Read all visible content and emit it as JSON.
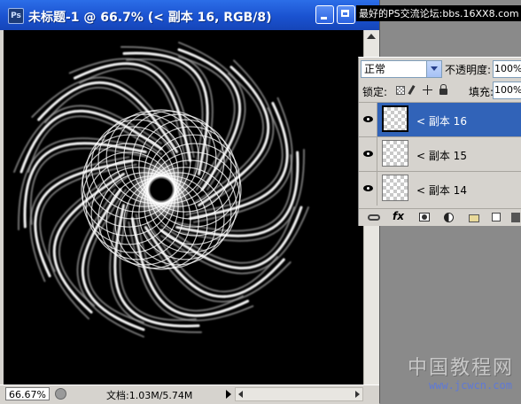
{
  "document": {
    "title": "未标题-1 @ 66.7% (< 副本 16, RGB/8)"
  },
  "banner": {
    "text": "最好的PS交流论坛:bbs.16XX8.com"
  },
  "status_bar": {
    "zoom": "66.67%",
    "doc_info": "文档:1.03M/5.74M"
  },
  "layers_panel": {
    "blend_mode": "正常",
    "opacity_label": "不透明度:",
    "opacity_value": "100%",
    "lock_label": "锁定:",
    "fill_label": "填充:",
    "fill_value": "100%",
    "layers": [
      {
        "name": "< 副本 16",
        "selected": true,
        "visible": true
      },
      {
        "name": "< 副本 15",
        "selected": false,
        "visible": true
      },
      {
        "name": "< 副本 14",
        "selected": false,
        "visible": true
      }
    ]
  },
  "watermark": {
    "line1": "中国教程网",
    "line2": "www.jcwcn.com"
  },
  "colors": {
    "title_bar": "#1a52d0",
    "selected_layer": "#3163b8",
    "canvas": "#000000"
  }
}
